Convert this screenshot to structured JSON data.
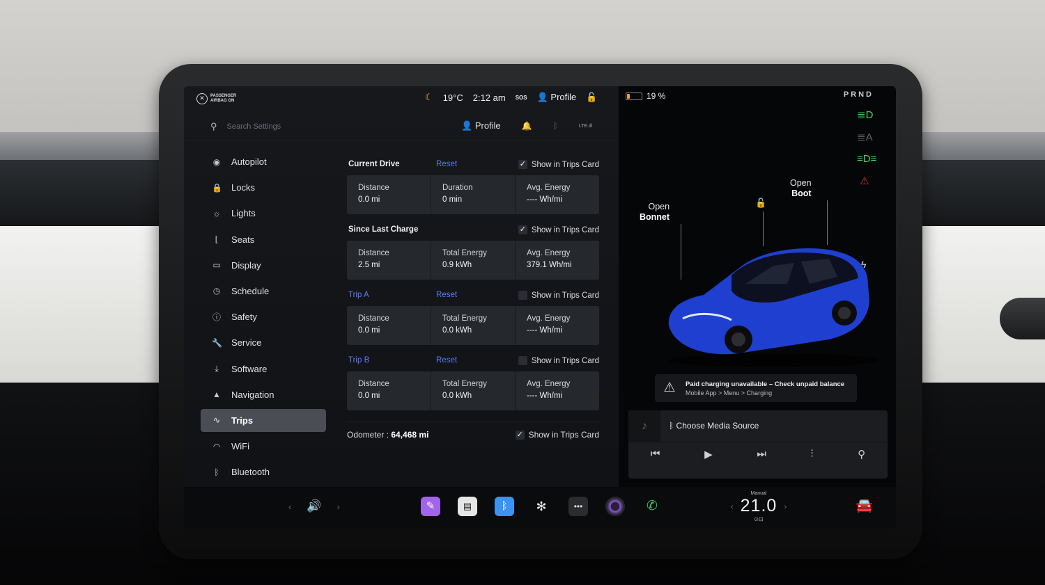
{
  "status_bar": {
    "airbag_label": "PASSENGER\nAIRBAG ON",
    "temperature": "19°C",
    "time": "2:12 am",
    "sos": "SOS",
    "profile": "Profile",
    "battery_percent": "19 %",
    "battery_level": 0.19
  },
  "subheader": {
    "search_placeholder": "Search Settings",
    "profile": "Profile",
    "lte": "LTE"
  },
  "sidebar": {
    "items": [
      {
        "label": "Autopilot",
        "icon": "steering-wheel-icon"
      },
      {
        "label": "Locks",
        "icon": "lock-icon"
      },
      {
        "label": "Lights",
        "icon": "light-icon"
      },
      {
        "label": "Seats",
        "icon": "seat-icon"
      },
      {
        "label": "Display",
        "icon": "display-icon"
      },
      {
        "label": "Schedule",
        "icon": "clock-icon"
      },
      {
        "label": "Safety",
        "icon": "alert-circle-icon"
      },
      {
        "label": "Service",
        "icon": "wrench-icon"
      },
      {
        "label": "Software",
        "icon": "download-icon"
      },
      {
        "label": "Navigation",
        "icon": "navigation-arrow-icon"
      },
      {
        "label": "Trips",
        "icon": "trips-icon",
        "active": true
      },
      {
        "label": "WiFi",
        "icon": "wifi-icon"
      },
      {
        "label": "Bluetooth",
        "icon": "bluetooth-icon"
      }
    ]
  },
  "trips": {
    "show_in_trips_card": "Show in Trips Card",
    "reset": "Reset",
    "sections": [
      {
        "title": "Current Drive",
        "has_reset": true,
        "checked": true,
        "cells": [
          {
            "label": "Distance",
            "value": "0.0  mi"
          },
          {
            "label": "Duration",
            "value": "0  min"
          },
          {
            "label": "Avg. Energy",
            "value": "----  Wh/mi"
          }
        ]
      },
      {
        "title": "Since Last Charge",
        "has_reset": false,
        "checked": true,
        "cells": [
          {
            "label": "Distance",
            "value": "2.5  mi"
          },
          {
            "label": "Total Energy",
            "value": "0.9  kWh"
          },
          {
            "label": "Avg. Energy",
            "value": "379.1  Wh/mi"
          }
        ]
      },
      {
        "title": "Trip A",
        "has_reset": true,
        "checked": false,
        "cells": [
          {
            "label": "Distance",
            "value": "0.0  mi"
          },
          {
            "label": "Total Energy",
            "value": "0.0  kWh"
          },
          {
            "label": "Avg. Energy",
            "value": "----  Wh/mi"
          }
        ]
      },
      {
        "title": "Trip B",
        "has_reset": true,
        "checked": false,
        "cells": [
          {
            "label": "Distance",
            "value": "0.0  mi"
          },
          {
            "label": "Total Energy",
            "value": "0.0  kWh"
          },
          {
            "label": "Avg. Energy",
            "value": "----  Wh/mi"
          }
        ]
      }
    ],
    "odometer_label": "Odometer  :",
    "odometer_value": "64,468  mi",
    "odometer_checked": true
  },
  "vehicle": {
    "prnd": "PRND",
    "open_bonnet_1": "Open",
    "open_bonnet_2": "Bonnet",
    "open_boot_1": "Open",
    "open_boot_2": "Boot",
    "alert_title": "Paid charging unavailable – Check unpaid balance",
    "alert_path": "Mobile App > Menu > Charging",
    "car_color": "#1f3fd1",
    "indicator_colors": {
      "headlights": "#3fd35a",
      "auto_lights": "#666666",
      "fog_lights": "#3fd35a",
      "seatbelt": "#e0302b"
    }
  },
  "media": {
    "source": "Choose Media Source"
  },
  "dock": {
    "temp_mode": "Manual",
    "temperature": "21.0"
  }
}
